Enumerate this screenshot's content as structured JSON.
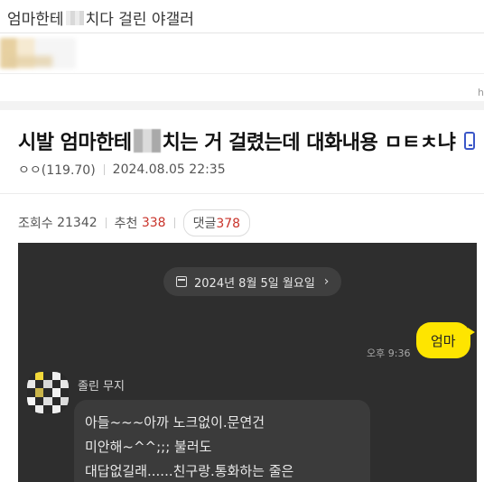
{
  "header": {
    "title_part1": "엄마한테",
    "title_part2": "치다 걸린 야갤러"
  },
  "corner_label": "h",
  "post": {
    "title_part1": "시발 엄마한테",
    "title_part2": "치는 거 걸렸는데 대화내용 ㅁㅌㅊ냐",
    "author": "ㅇㅇ(119.70)",
    "datetime": "2024.08.05 22:35",
    "views_label": "조회수",
    "views": "21342",
    "likes_label": "추천",
    "likes": "338",
    "comments_label": "댓글",
    "comments": "378"
  },
  "chat": {
    "date": "2024년 8월 5일 월요일",
    "sent_time": "오후 9:36",
    "sent_message": "엄마",
    "sender_name": "졸린 무지",
    "reply_lines": [
      "아들~~~아까 노크없이.문연건",
      "미안해~^^;;; 불러도",
      "대답없길래......친구랑.통화하는 줄은"
    ]
  },
  "colors": {
    "accent_red": "#c9342b",
    "chat_bg": "#2e2e2e",
    "my_bubble": "#fee500",
    "other_bubble": "#3b3b3b",
    "phone_icon": "#3b57c8"
  },
  "icons": [
    "calendar-icon",
    "chevron-right-icon",
    "phone-icon",
    "avatar"
  ]
}
